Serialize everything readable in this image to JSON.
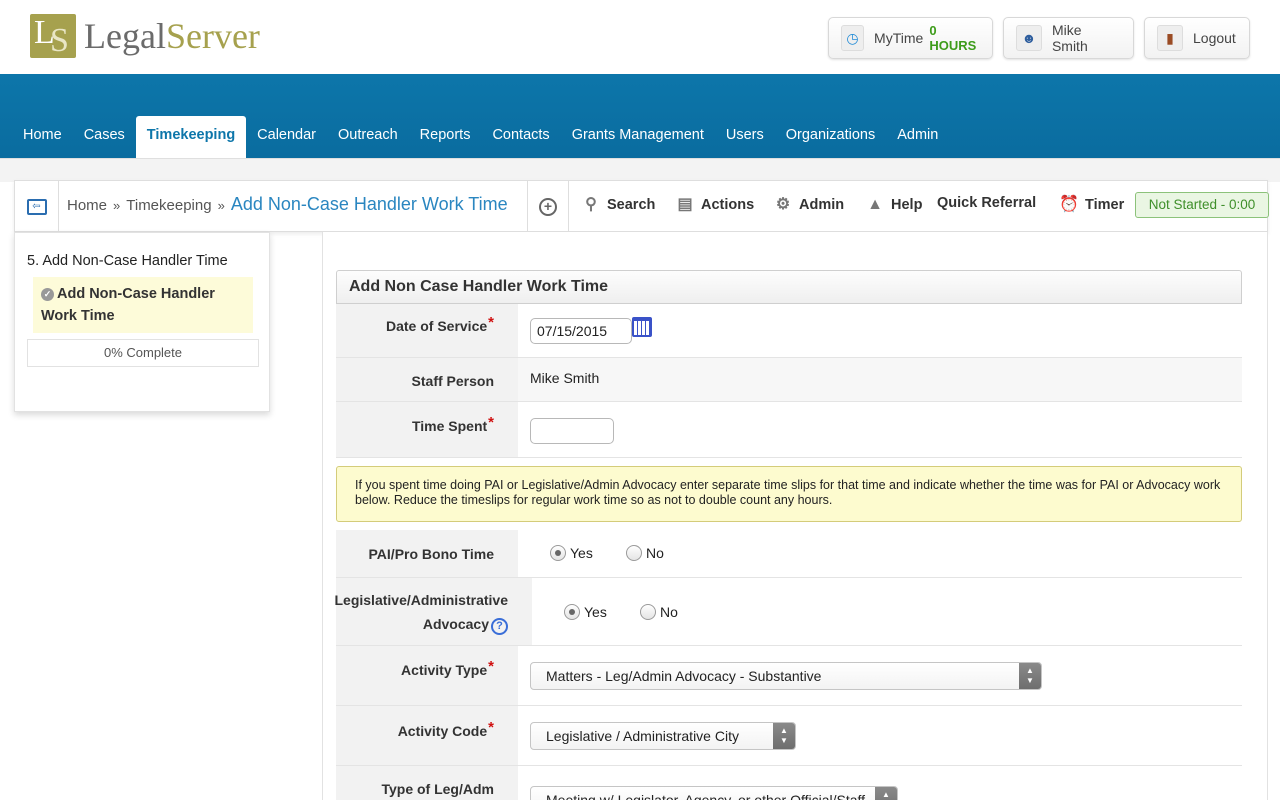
{
  "header": {
    "logo_legal": "Legal",
    "logo_server": "Server",
    "mytime_label": "MyTime",
    "mytime_hours": "0 HOURS",
    "user_name": "Mike Smith",
    "logout_label": "Logout"
  },
  "nav": {
    "items": [
      "Home",
      "Cases",
      "Timekeeping",
      "Calendar",
      "Outreach",
      "Reports",
      "Contacts",
      "Grants Management",
      "Users",
      "Organizations",
      "Admin"
    ],
    "active": "Timekeeping"
  },
  "toolbar": {
    "breadcrumb": [
      "Home",
      "Timekeeping"
    ],
    "breadcrumb_sep": "»",
    "current": "Add Non-Case Handler Work Time",
    "search": "Search",
    "actions": "Actions",
    "admin": "Admin",
    "help": "Help",
    "quick_referral": "Quick Referral",
    "timer": "Timer",
    "timer_status": "Not Started - 0:00"
  },
  "sidebar": {
    "title": "5. Add Non-Case Handler Time",
    "step": "Add Non-Case Handler Work Time",
    "progress": "0% Complete"
  },
  "form": {
    "title": "Add Non Case Handler Work Time",
    "date_label": "Date of Service",
    "date_value": "07/15/2015",
    "staff_label": "Staff Person",
    "staff_value": "Mike Smith",
    "time_label": "Time Spent",
    "time_value": "",
    "notice": "If you spent time doing PAI or Legislative/Admin Advocacy enter separate time slips for that time and indicate whether the time was for PAI or Advocacy work below. Reduce the timeslips for regular work time so as not to double count any hours.",
    "pai_label": "PAI/Pro Bono Time",
    "pai_selected": "Yes",
    "leg_label_1": "Legislative/Administrative",
    "leg_label_2": "Advocacy",
    "leg_selected": "Yes",
    "yes": "Yes",
    "no": "No",
    "activity_type_label": "Activity Type",
    "activity_type_value": "Matters - Leg/Admin Advocacy - Substantive",
    "activity_code_label": "Activity Code",
    "activity_code_value": "Legislative / Administrative City",
    "leg_type_label": "Type of Leg/Adm",
    "leg_type_value": "Meeting w/ Legislator, Agency, or other Official/Staff"
  },
  "colors": {
    "nav_blue": "#0d76aa",
    "brand_olive": "#a6a14e",
    "required_red": "#d01010",
    "timer_green": "#3f8f2a"
  }
}
